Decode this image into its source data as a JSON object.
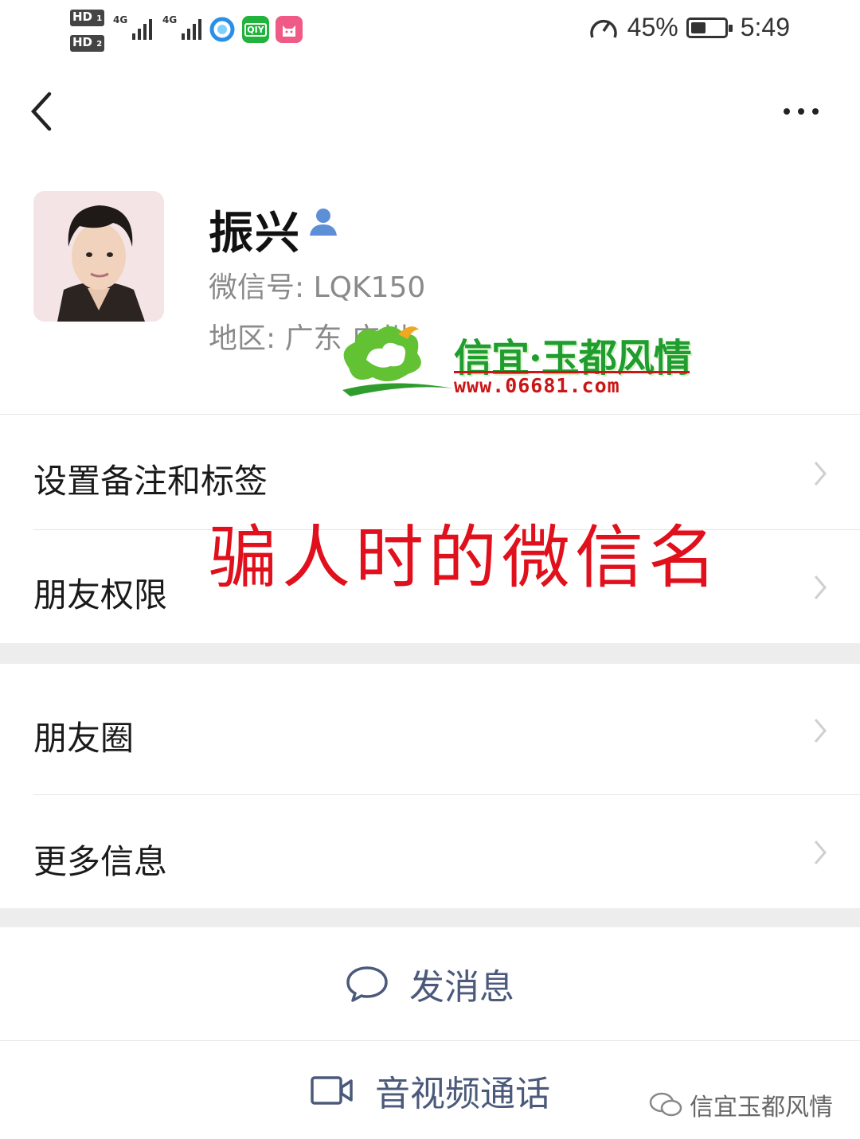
{
  "status_bar": {
    "sim1": "HD",
    "sim1_slot": "1",
    "sim2": "HD",
    "sim2_slot": "2",
    "network1": "4G",
    "network2": "4G",
    "speed": "45%",
    "battery_level": 0.45,
    "time": "5:49",
    "app_icons": [
      "browser-icon",
      "iqiyi-icon",
      "cat-app-icon"
    ],
    "iqiyi_label": "QIY"
  },
  "nav": {
    "back_icon": "chevron-left-icon",
    "more_icon": "more-dots-icon"
  },
  "profile": {
    "name": "振兴",
    "wechat_id": "微信号: LQK150",
    "region": "地区: 广东  广州"
  },
  "watermark": {
    "title": "信宜·玉都风情",
    "url": "www.06681.com"
  },
  "menu": {
    "remark_label": "设置备注和标签",
    "permission_label": "朋友权限",
    "moments_label": "朋友圈",
    "more_info_label": "更多信息"
  },
  "overlay": {
    "text": "骗人时的微信名",
    "color": "#e0101c"
  },
  "actions": {
    "message_label": "发消息",
    "call_label": "音视频通话"
  },
  "footer": {
    "brand": "信宜玉都风情"
  },
  "colors": {
    "accent": "#4b5a7a",
    "watermark_green": "#1f9d2e",
    "watermark_red": "#cc1515"
  }
}
